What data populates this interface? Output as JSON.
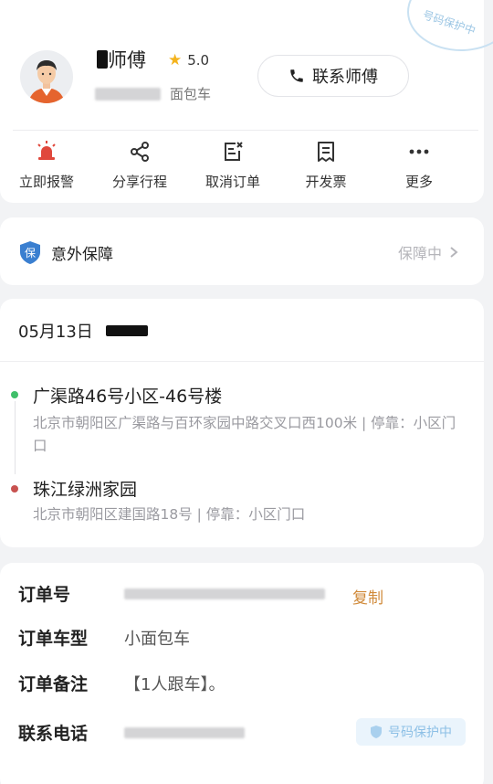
{
  "driver": {
    "name_suffix": "师傅",
    "rating": "5.0",
    "car_type": "面包车",
    "contact_label": "联系师傅"
  },
  "stamp": {
    "text": "号码保护中"
  },
  "actions": [
    {
      "label": "立即报警",
      "icon": "alarm-icon"
    },
    {
      "label": "分享行程",
      "icon": "share-icon"
    },
    {
      "label": "取消订单",
      "icon": "cancel-order-icon"
    },
    {
      "label": "开发票",
      "icon": "invoice-icon"
    },
    {
      "label": "更多",
      "icon": "more-icon"
    }
  ],
  "insurance": {
    "label": "意外保障",
    "status": "保障中",
    "icon_char": "保"
  },
  "trip": {
    "date": "05月13日",
    "start": {
      "name": "广渠路46号小区-46号楼",
      "address": "北京市朝阳区广渠路与百环家园中路交叉口西100米 | 停靠：小区门口"
    },
    "end": {
      "name": "珠江绿洲家园",
      "address": "北京市朝阳区建国路18号 | 停靠：小区门口"
    }
  },
  "order": {
    "number_label": "订单号",
    "copy_label": "复制",
    "vehicle_label": "订单车型",
    "vehicle_value": "小面包车",
    "note_label": "订单备注",
    "note_value": "【1人跟车】。",
    "phone_label": "联系电话",
    "phone_badge": "号码保护中"
  },
  "colors": {
    "accent_orange": "#d08a3a",
    "alarm_red": "#e0483c",
    "start_green": "#3fbf6a",
    "end_red": "#c85250",
    "shield_blue": "#3a7fd0"
  }
}
